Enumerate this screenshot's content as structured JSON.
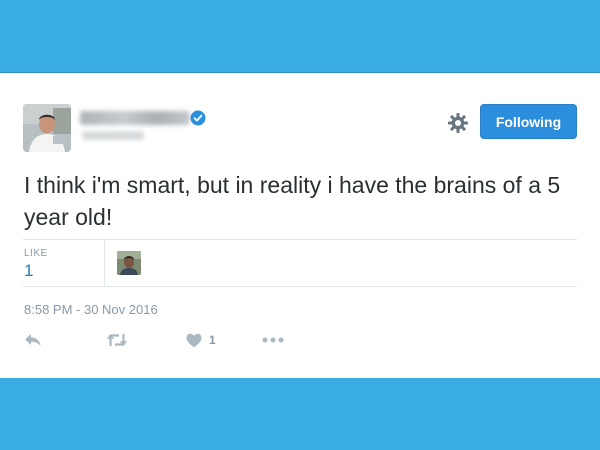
{
  "tweet": {
    "text": "I think i'm smart, but in reality i have the brains of a 5 year old!",
    "follow_label": "Following",
    "likes_label": "LIKE",
    "likes_count": "1",
    "timestamp": "8:58 PM - 30 Nov 2016",
    "like_action_count": "1"
  },
  "icons": {
    "verified": "verified-badge-icon",
    "settings": "gear-icon",
    "reply": "reply-icon",
    "retweet": "retweet-icon",
    "like": "heart-icon",
    "more": "more-icon"
  },
  "colors": {
    "background": "#3aace4",
    "card": "#ffffff",
    "button": "#2b8fdd",
    "text": "#292f33",
    "muted": "#8899a6",
    "link": "#2b7bb9"
  }
}
